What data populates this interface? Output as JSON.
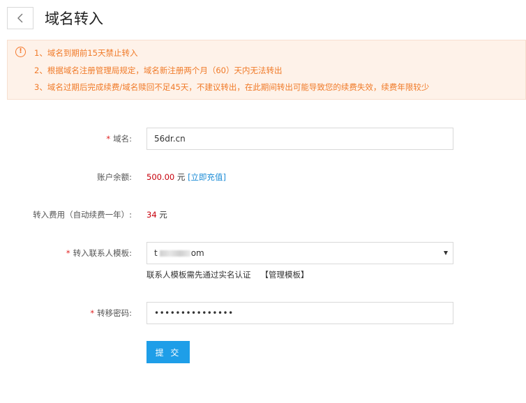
{
  "header": {
    "back_icon": "chevron-left-icon",
    "title": "域名转入"
  },
  "notice": {
    "icon": "exclamation-circle-icon",
    "color": "#f07a28",
    "lines": [
      "1、域名到期前15天禁止转入",
      "2、根据域名注册管理局规定，域名新注册两个月（60）天内无法转出",
      "3、域名过期后完成续费/域名赎回不足45天，不建议转出，在此期间转出可能导致您的续费失效，续费年限较少"
    ]
  },
  "form": {
    "required_mark": "*",
    "domain": {
      "label": "域名:",
      "value": "56dr.cn"
    },
    "balance": {
      "label": "账户余额:",
      "amount": "500.00",
      "unit": "元",
      "recharge_link": "[立即充值]"
    },
    "fee": {
      "label": "转入费用（自动续费一年）:",
      "amount": "34",
      "unit": "元"
    },
    "contact_template": {
      "label": "转入联系人模板:",
      "value_prefix": "t",
      "value_suffix": "om",
      "hint": "联系人模板需先通过实名认证",
      "manage_link": "【管理模板】"
    },
    "transfer_code": {
      "label": "转移密码:",
      "value": "•••••••••••••••"
    },
    "submit_label": "提 交"
  },
  "colors": {
    "accent": "#1e9ee8",
    "money": "#c7000b",
    "link": "#1a8bd6",
    "required": "#e02020"
  }
}
